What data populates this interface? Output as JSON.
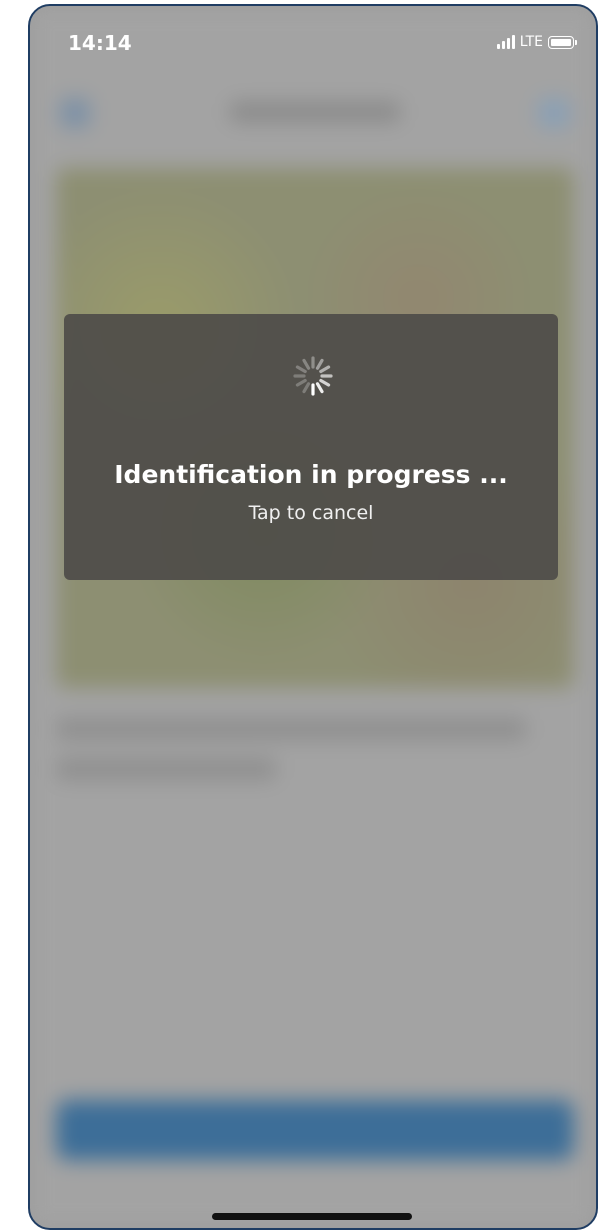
{
  "status_bar": {
    "time": "14:14",
    "network": "LTE"
  },
  "overlay": {
    "title": "Identification in progress ...",
    "subtitle": "Tap to cancel",
    "icon": "spinner-icon"
  },
  "colors": {
    "overlay_bg": "#4e4c49",
    "dim_bg": "#9c9c9c",
    "button_blue": "#3d6e98",
    "frame_border": "#1f3d63"
  }
}
